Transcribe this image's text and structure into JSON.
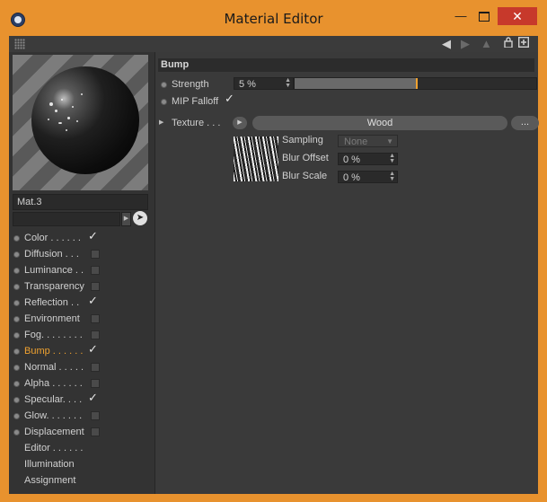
{
  "window": {
    "title": "Material Editor",
    "accent_color": "#e8922e",
    "close_glyph": "✕",
    "minimize_glyph": "—"
  },
  "toolbar": {
    "icons": [
      "grip-icon",
      "arrow-left-icon",
      "arrow-right-icon",
      "up-icon",
      "lock-icon",
      "new-window-icon"
    ]
  },
  "material": {
    "name": "Mat.3"
  },
  "channels": [
    {
      "label": "Color . . . . . .",
      "state": "checked"
    },
    {
      "label": "Diffusion . . .",
      "state": "unchecked"
    },
    {
      "label": "Luminance . .",
      "state": "unchecked"
    },
    {
      "label": "Transparency",
      "state": "unchecked"
    },
    {
      "label": "Reflection . .",
      "state": "checked"
    },
    {
      "label": "Environment",
      "state": "unchecked"
    },
    {
      "label": "Fog. . . . . . . .",
      "state": "unchecked"
    },
    {
      "label": "Bump . . . . . .",
      "state": "checked",
      "active": true
    },
    {
      "label": "Normal . . . . .",
      "state": "unchecked"
    },
    {
      "label": "Alpha . . . . . .",
      "state": "unchecked"
    },
    {
      "label": "Specular. . . .",
      "state": "checked"
    },
    {
      "label": "Glow. . . . . . .",
      "state": "unchecked"
    },
    {
      "label": "Displacement",
      "state": "unchecked"
    },
    {
      "label": "Editor . . . . . .",
      "state": "none"
    },
    {
      "label": "Illumination",
      "state": "none"
    },
    {
      "label": "Assignment",
      "state": "none"
    }
  ],
  "bump": {
    "header": "Bump",
    "strength_label": "Strength",
    "strength_value": "5 %",
    "strength_fraction": 0.5,
    "mip_label": "MIP Falloff",
    "mip_checked": true,
    "texture_label": "Texture . . .",
    "texture_name": "Wood",
    "texture_more": "...",
    "sampling_label": "Sampling",
    "sampling_value": "None",
    "blur_offset_label": "Blur Offset",
    "blur_offset_value": "0 %",
    "blur_scale_label": "Blur Scale",
    "blur_scale_value": "0 %"
  },
  "check_glyph": "✓"
}
